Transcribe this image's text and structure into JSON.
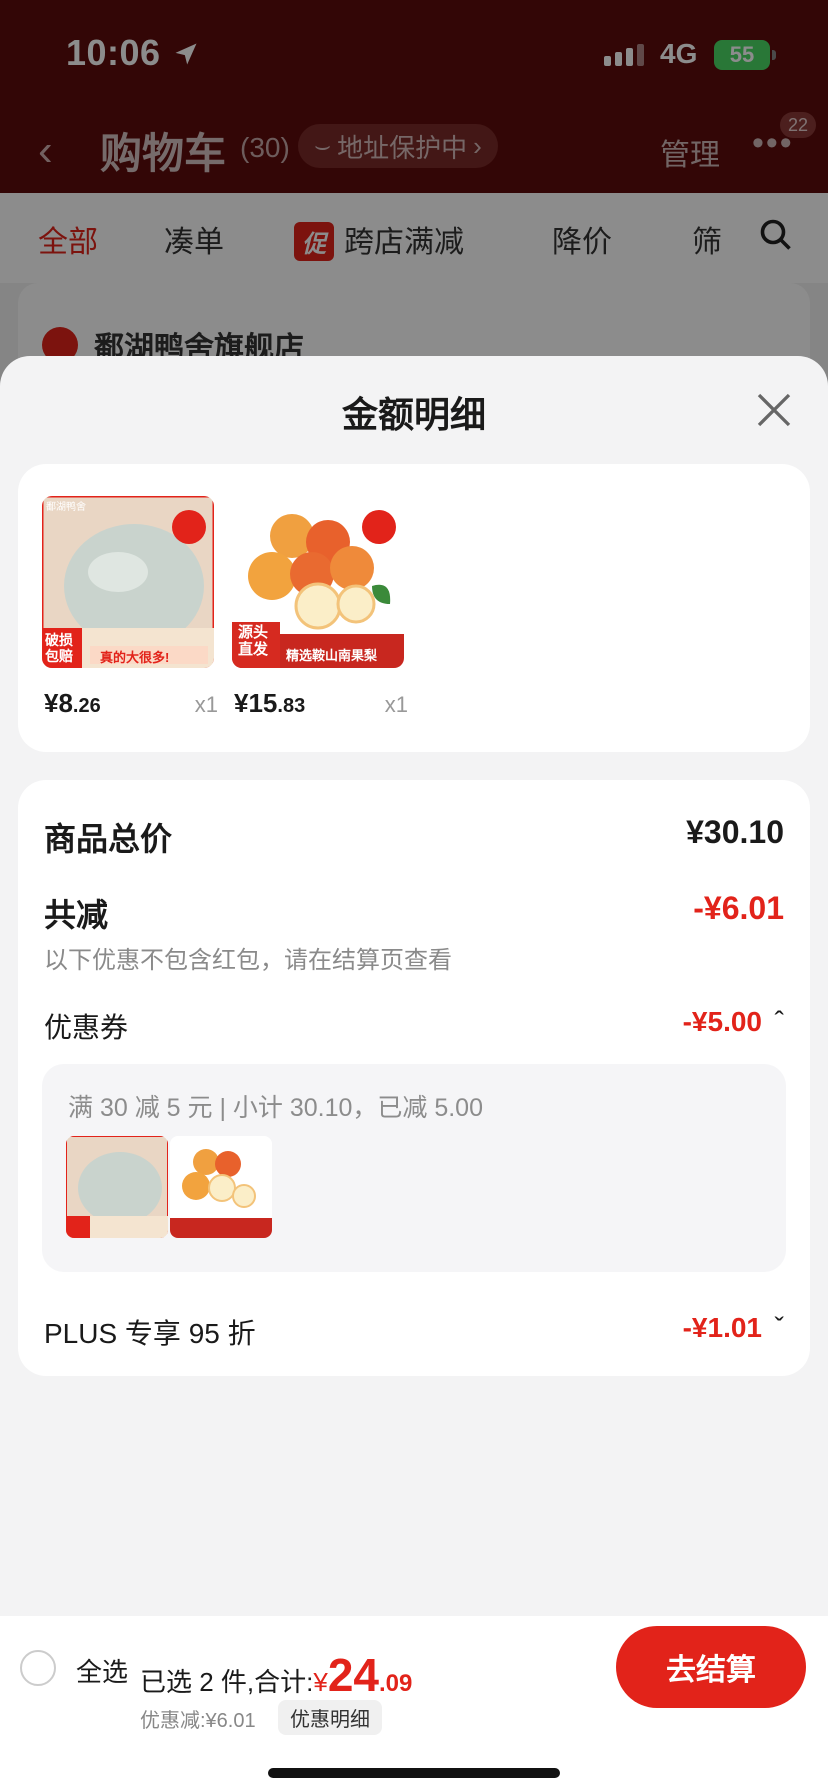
{
  "status": {
    "time": "10:06",
    "network": "4G",
    "battery": "55"
  },
  "nav": {
    "title": "购物车",
    "count": "(30)",
    "address_tag": "地址保护中",
    "manage": "管理",
    "badge": "22"
  },
  "tabs": {
    "all": "全部",
    "combine": "凑单",
    "promo_tag": "促",
    "cross_store": "跨店满减",
    "price_drop": "降价",
    "filter": "筛"
  },
  "shop": {
    "name": "鄱湖鸭舍旗舰店"
  },
  "sheet": {
    "title": "金额明细",
    "items": [
      {
        "price_int": "¥8",
        "price_dec": ".26",
        "qty": "x1",
        "label_a": "破损",
        "label_b": "包赔",
        "banner": "真的大很多!",
        "brand": "鄱湖鸭舍"
      },
      {
        "price_int": "¥15",
        "price_dec": ".83",
        "qty": "x1",
        "label_a": "源头",
        "label_b": "直发",
        "banner": "精选鞍山南果梨"
      }
    ],
    "summary": {
      "total_label": "商品总价",
      "total_value": "¥30.10",
      "reduce_label": "共减",
      "reduce_value": "-¥6.01",
      "reduce_hint": "以下优惠不包含红包，请在结算页查看",
      "coupon_label": "优惠券",
      "coupon_value": "-¥5.00",
      "coupon_detail": "满 30 减 5 元 | 小计 30.10，已减 5.00",
      "plus_label": "PLUS 专享 95 折",
      "plus_value": "-¥1.01"
    }
  },
  "bottom": {
    "select_all": "全选",
    "selected_text": "已选 2 件,合计:",
    "yen": "¥",
    "total_int": "24",
    "total_dec": ".09",
    "discount_text": "优惠减:¥6.01",
    "detail_button": "优惠明细",
    "checkout": "去结算"
  },
  "colors": {
    "accent": "#e2231a",
    "header": "#5e0c0b",
    "sheet_bg": "#f3f3f4"
  }
}
